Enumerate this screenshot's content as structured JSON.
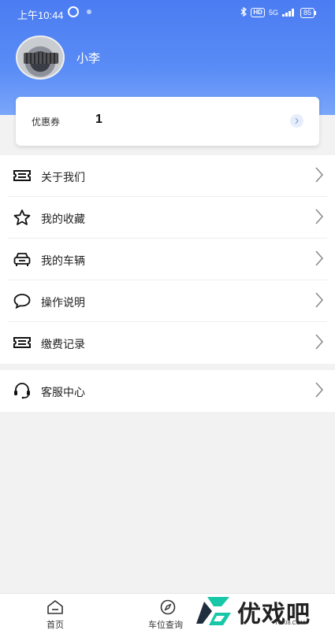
{
  "status_bar": {
    "time": "上午10:44",
    "hd_badge": "HD",
    "network": "5G",
    "battery": "85"
  },
  "profile": {
    "username": "小李"
  },
  "coupon": {
    "label": "优惠券",
    "count": "1"
  },
  "menu": {
    "items": [
      {
        "label": "关于我们",
        "icon": "ticket-icon"
      },
      {
        "label": "我的收藏",
        "icon": "star-icon"
      },
      {
        "label": "我的车辆",
        "icon": "car-icon"
      },
      {
        "label": "操作说明",
        "icon": "chat-bubble-icon"
      },
      {
        "label": "缴费记录",
        "icon": "ticket-icon"
      }
    ]
  },
  "support": {
    "label": "客服中心",
    "icon": "headset-icon"
  },
  "tabbar": {
    "items": [
      {
        "label": "首页",
        "icon": "home-icon"
      },
      {
        "label": "车位查询",
        "icon": "compass-icon"
      }
    ]
  },
  "watermark": {
    "text": "优戏吧",
    "url": "YOXI8.COM"
  },
  "colors": {
    "header_blue": "#4b7cf2",
    "page_bg": "#f2f2f2"
  }
}
